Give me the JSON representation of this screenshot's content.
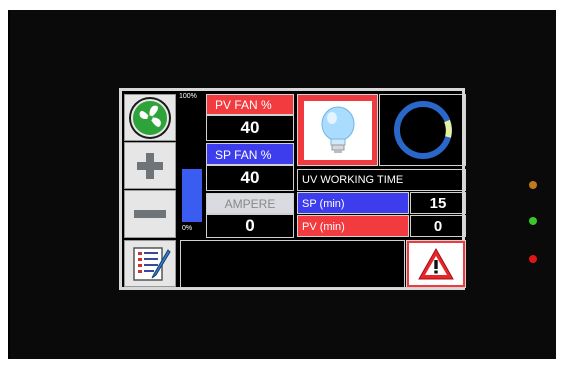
{
  "panel": {
    "bar_top_label": "100%",
    "bar_bottom_label": "0%",
    "bar_level": 0.45,
    "pv_fan_label": "PV FAN %",
    "pv_fan_value": "40",
    "sp_fan_label": "SP FAN %",
    "sp_fan_value": "40",
    "ampere_label": "AMPERE",
    "ampere_value": "0",
    "uv_title": "UV WORKING TIME",
    "sp_min_label": "SP (min)",
    "sp_min_value": "15",
    "pv_min_label": "PV (min)",
    "pv_min_value": "0"
  },
  "icons": [
    "fan-icon",
    "plus-icon",
    "minus-icon",
    "document-pen-icon",
    "bulb-icon",
    "ring-icon",
    "warning-icon"
  ],
  "leds": {
    "top": "#c07a1a",
    "middle": "#39c828",
    "bottom": "#e01515"
  },
  "colors": {
    "red": "#f23b3f",
    "blue": "#3d3dee",
    "bar_blue": "#3a5cf0",
    "ring": "#2a67c8"
  }
}
